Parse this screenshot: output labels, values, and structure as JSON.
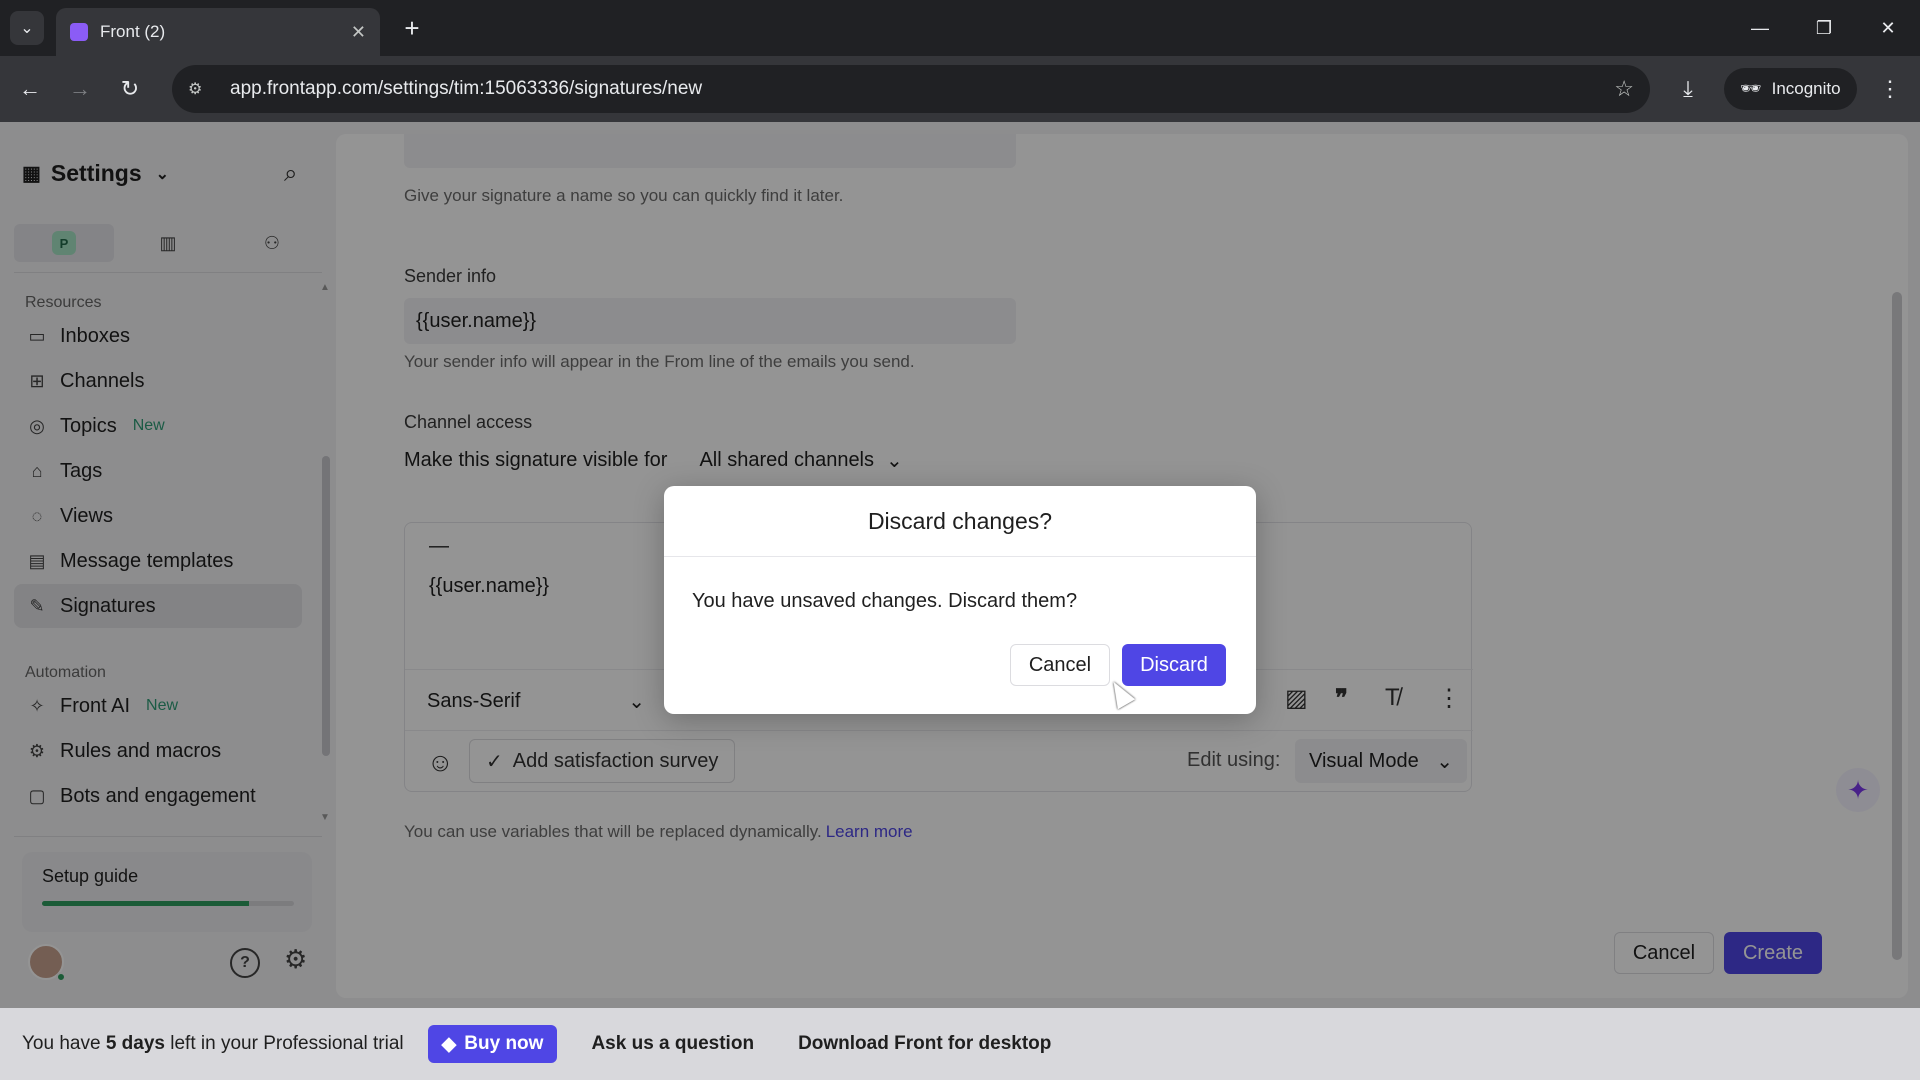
{
  "browser": {
    "tab_title": "Front (2)",
    "url": "app.frontapp.com/settings/tim:15063336/signatures/new",
    "incognito_label": "Incognito"
  },
  "sidebar": {
    "title": "Settings",
    "scope_tabs": [
      {
        "label": "P",
        "icon": "personal-badge"
      },
      {
        "label": "",
        "icon": "building-icon"
      },
      {
        "label": "",
        "icon": "person-icon"
      }
    ],
    "resources_label": "Resources",
    "resources": [
      {
        "label": "Inboxes",
        "icon": "inbox-icon"
      },
      {
        "label": "Channels",
        "icon": "grid-icon"
      },
      {
        "label": "Topics",
        "icon": "topics-icon",
        "badge": "New"
      },
      {
        "label": "Tags",
        "icon": "tag-icon"
      },
      {
        "label": "Views",
        "icon": "views-icon"
      },
      {
        "label": "Message templates",
        "icon": "template-icon"
      },
      {
        "label": "Signatures",
        "icon": "pen-icon",
        "active": true
      }
    ],
    "automation_label": "Automation",
    "automation": [
      {
        "label": "Front AI",
        "icon": "sparkle-icon",
        "badge": "New"
      },
      {
        "label": "Rules and macros",
        "icon": "gear-icon"
      },
      {
        "label": "Bots and engagement",
        "icon": "chat-icon"
      }
    ],
    "setup_guide": {
      "label": "Setup guide",
      "progress": 0.82
    }
  },
  "form": {
    "name_hint": "Give your signature a name so you can quickly find it later.",
    "sender_label": "Sender info",
    "sender_value": "{{user.name}}",
    "sender_hint": "Your sender info will appear in the From line of the emails you send.",
    "channel_label": "Channel access",
    "visible_prefix": "Make this signature visible for",
    "visible_value": "All shared channels",
    "editor_dash": "—",
    "editor_body": "{{user.name}}",
    "font_value": "Sans-Serif",
    "survey_label": "Add satisfaction survey",
    "edit_using_label": "Edit using:",
    "mode_value": "Visual Mode",
    "vars_note": "You can use variables that will be replaced dynamically.",
    "learn_more": "Learn more",
    "cancel_label": "Cancel",
    "create_label": "Create"
  },
  "modal": {
    "title": "Discard changes?",
    "message": "You have unsaved changes. Discard them?",
    "cancel_label": "Cancel",
    "discard_label": "Discard"
  },
  "banner": {
    "trial_prefix": "You have",
    "trial_days": "5 days",
    "trial_suffix": "left in your Professional trial",
    "buy_now": "Buy now",
    "ask_question": "Ask us a question",
    "download": "Download Front for desktop"
  },
  "colors": {
    "accent": "#4f46e5",
    "success": "#2f9e5f"
  }
}
